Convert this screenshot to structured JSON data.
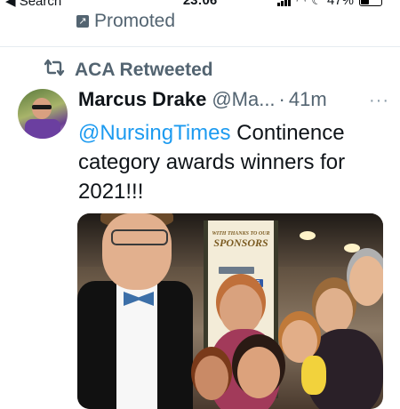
{
  "status_bar": {
    "back_label": "◀ Search",
    "time": "23:06",
    "battery": "47%",
    "battery_level": 0.47
  },
  "promoted": {
    "label": "Promoted",
    "icon": "promoted-arrow-icon"
  },
  "retweet": {
    "label": "ACA Retweeted",
    "icon": "retweet-icon"
  },
  "tweet": {
    "author_name": "Marcus Drake",
    "author_handle": "@Ma...",
    "dot": "·",
    "time_ago": "41m",
    "more_label": "···",
    "mention": "@NursingTimes",
    "body": " Continence category awards winners for 2021!!!",
    "photo": {
      "banner_heading": "SPONSORS",
      "banner_subheading": "WITH THANKS TO OUR",
      "logo_text": "NHS"
    }
  },
  "colors": {
    "accent": "#1d9bf0",
    "secondary_text": "#536471",
    "divider": "#e6ecf0"
  }
}
